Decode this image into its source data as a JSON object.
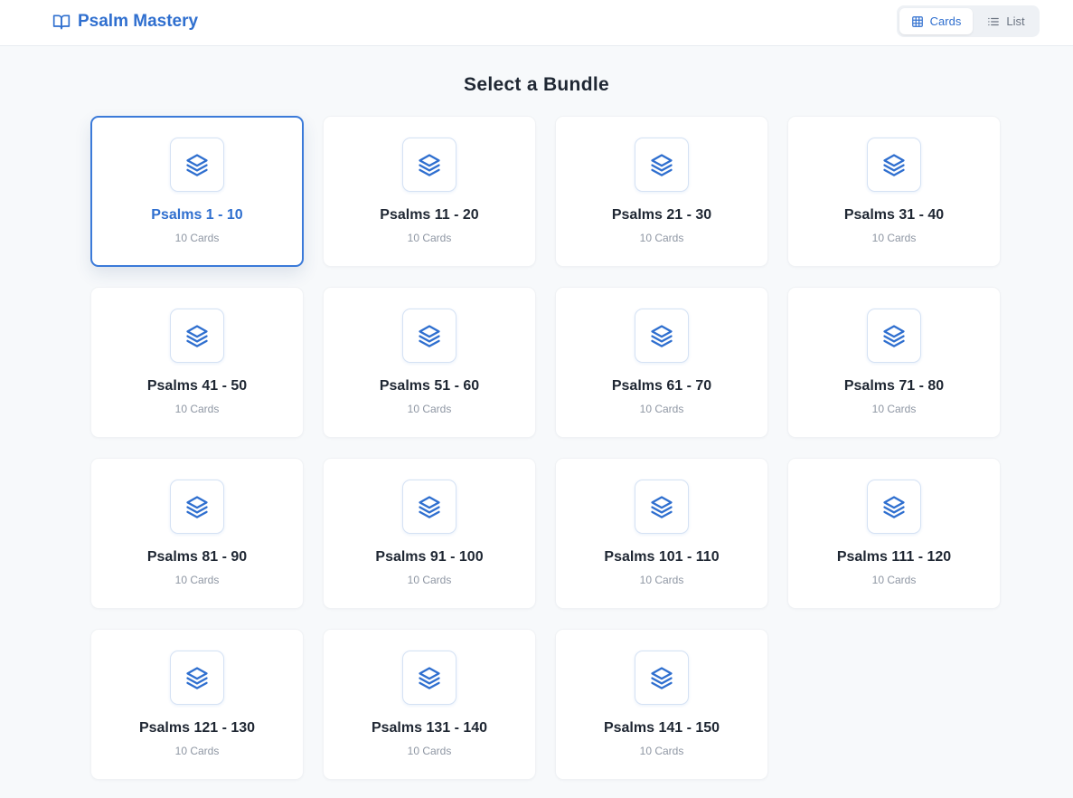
{
  "app": {
    "title": "Psalm Mastery"
  },
  "view_toggle": {
    "cards_label": "Cards",
    "list_label": "List",
    "active": "Cards"
  },
  "page": {
    "heading": "Select a Bundle"
  },
  "colors": {
    "accent": "#2f6fcf",
    "background": "#f7f9fb",
    "muted": "#8e96a3"
  },
  "bundles": [
    {
      "title": "Psalms 1 - 10",
      "count": "10 Cards",
      "selected": true
    },
    {
      "title": "Psalms 11 - 20",
      "count": "10 Cards"
    },
    {
      "title": "Psalms 21 - 30",
      "count": "10 Cards"
    },
    {
      "title": "Psalms 31 - 40",
      "count": "10 Cards"
    },
    {
      "title": "Psalms 41 - 50",
      "count": "10 Cards"
    },
    {
      "title": "Psalms 51 - 60",
      "count": "10 Cards"
    },
    {
      "title": "Psalms 61 - 70",
      "count": "10 Cards"
    },
    {
      "title": "Psalms 71 - 80",
      "count": "10 Cards"
    },
    {
      "title": "Psalms 81 - 90",
      "count": "10 Cards"
    },
    {
      "title": "Psalms 91 - 100",
      "count": "10 Cards"
    },
    {
      "title": "Psalms 101 - 110",
      "count": "10 Cards"
    },
    {
      "title": "Psalms 111 - 120",
      "count": "10 Cards"
    },
    {
      "title": "Psalms 121 - 130",
      "count": "10 Cards"
    },
    {
      "title": "Psalms 131 - 140",
      "count": "10 Cards"
    },
    {
      "title": "Psalms 141 - 150",
      "count": "10 Cards"
    }
  ]
}
